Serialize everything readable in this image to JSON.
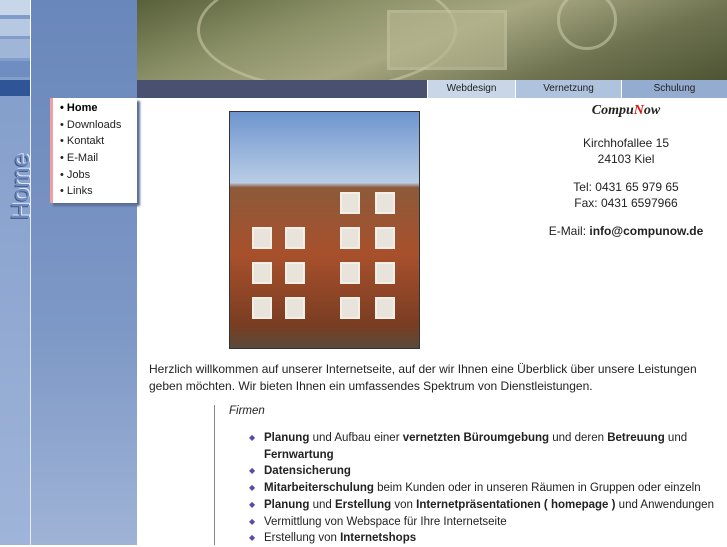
{
  "side_title": "Home",
  "nav_tabs": [
    {
      "label": "Webdesign",
      "color": "#c9d6e8"
    },
    {
      "label": "Vernetzung",
      "color": "#b0c3de"
    },
    {
      "label": "Schulung",
      "color": "#93acd0"
    }
  ],
  "menu": [
    {
      "label": "Home",
      "active": true
    },
    {
      "label": "Downloads"
    },
    {
      "label": "Kontakt"
    },
    {
      "label": "E-Mail"
    },
    {
      "label": "Jobs"
    },
    {
      "label": "Links"
    }
  ],
  "contact": {
    "logo_pre": "Compu",
    "logo_n": "N",
    "logo_post": "ow",
    "street": "Kirchhofallee 15",
    "city": "24103 Kiel",
    "tel": "Tel: 0431 65 979 65",
    "fax": "Fax: 0431 6597966",
    "email_label": "E-Mail:",
    "email": "info@compunow.de"
  },
  "intro": "Herzlich willkommen auf unserer Internetseite, auf der wir Ihnen eine Überblick über unsere Leistungen geben möchten. Wir bieten Ihnen ein umfassendes Spektrum von Dienstleistungen.",
  "section_title": "Firmen",
  "services": [
    [
      [
        "Planung",
        1
      ],
      [
        " und Aufbau einer ",
        0
      ],
      [
        "vernetzten Büroumgebung",
        1
      ],
      [
        " und deren ",
        0
      ],
      [
        "Betreuung",
        1
      ],
      [
        " und ",
        0
      ],
      [
        "Fernwartung",
        1
      ]
    ],
    [
      [
        "Datensicherung",
        1
      ]
    ],
    [
      [
        "Mitarbeiterschulung",
        1
      ],
      [
        " beim Kunden  oder in unseren Räumen in Gruppen oder einzeln",
        0
      ]
    ],
    [
      [
        "Planung",
        1
      ],
      [
        " und ",
        0
      ],
      [
        "Erstellung",
        1
      ],
      [
        " von ",
        0
      ],
      [
        "Internetpräsentationen ( homepage )",
        1
      ],
      [
        " und Anwendungen",
        0
      ]
    ],
    [
      [
        "Vermittlung von Webspace für Ihre Internetseite",
        0
      ]
    ],
    [
      [
        "Erstellung von ",
        0
      ],
      [
        "Internetshops",
        1
      ]
    ]
  ]
}
